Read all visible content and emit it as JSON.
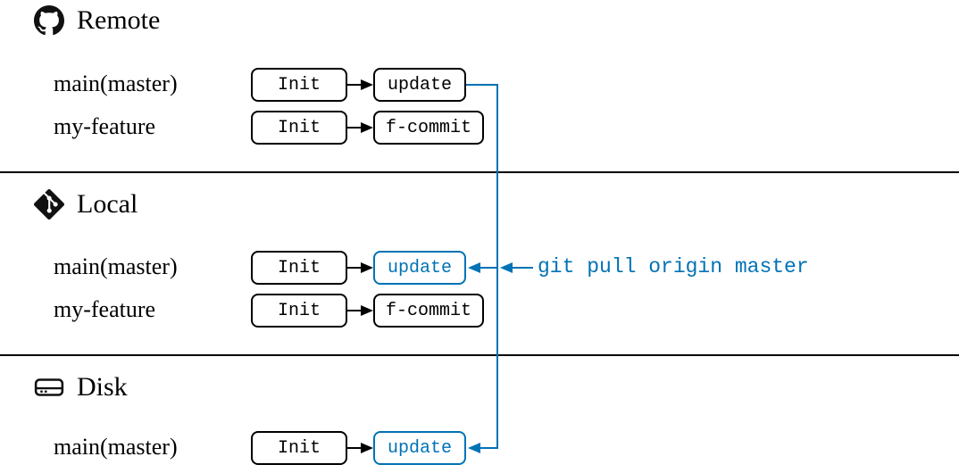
{
  "sections": {
    "remote": {
      "title": "Remote",
      "icon": "github-icon"
    },
    "local": {
      "title": "Local",
      "icon": "git-icon"
    },
    "disk": {
      "title": "Disk",
      "icon": "disk-icon"
    }
  },
  "branches": {
    "remote_main": "main(master)",
    "remote_feature": "my-feature",
    "local_main": "main(master)",
    "local_feature": "my-feature",
    "disk_main": "main(master)"
  },
  "commits": {
    "remote_main_init": "Init",
    "remote_main_update": "update",
    "remote_feature_init": "Init",
    "remote_feature_commit": "f-commit",
    "local_main_init": "Init",
    "local_main_update": "update",
    "local_feature_init": "Init",
    "local_feature_commit": "f-commit",
    "disk_main_init": "Init",
    "disk_main_update": "update"
  },
  "command": "git pull origin master",
  "colors": {
    "accent": "#0072b5"
  }
}
